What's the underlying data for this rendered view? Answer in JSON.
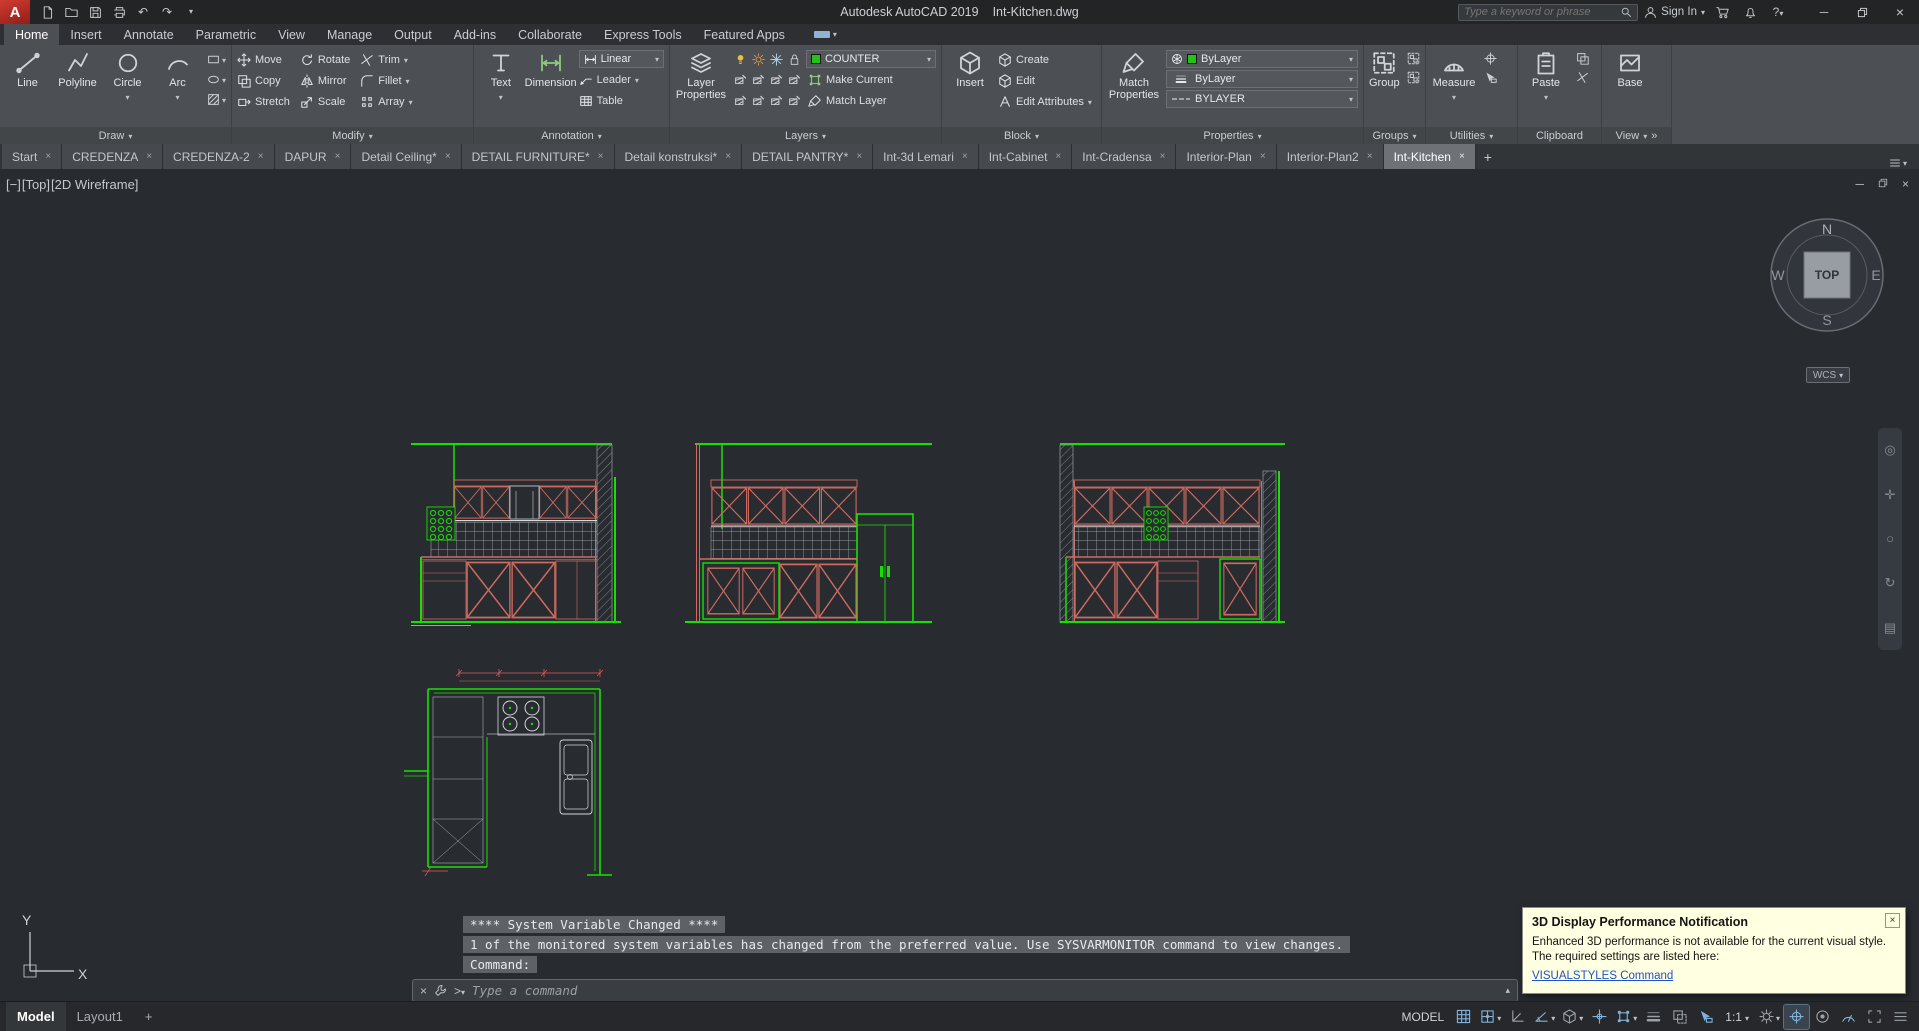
{
  "title_bar": {
    "app_title": "Autodesk AutoCAD 2019",
    "doc_title": "Int-Kitchen.dwg",
    "search_placeholder": "Type a keyword or phrase",
    "sign_in_label": "Sign In"
  },
  "menu_tabs": [
    {
      "label": "Home",
      "active": true
    },
    {
      "label": "Insert"
    },
    {
      "label": "Annotate"
    },
    {
      "label": "Parametric"
    },
    {
      "label": "View"
    },
    {
      "label": "Manage"
    },
    {
      "label": "Output"
    },
    {
      "label": "Add-ins"
    },
    {
      "label": "Collaborate"
    },
    {
      "label": "Express Tools"
    },
    {
      "label": "Featured Apps"
    }
  ],
  "ribbon": {
    "draw": {
      "title": "Draw",
      "buttons": [
        "Line",
        "Polyline",
        "Circle",
        "Arc"
      ]
    },
    "modify": {
      "title": "Modify",
      "buttons": [
        "Move",
        "Rotate",
        "Trim",
        "Copy",
        "Mirror",
        "Fillet",
        "Stretch",
        "Scale",
        "Array"
      ]
    },
    "annotation": {
      "title": "Annotation",
      "text": "Text",
      "dimension": "Dimension",
      "linear": "Linear",
      "leader": "Leader",
      "table": "Table"
    },
    "layers": {
      "title": "Layers",
      "layer_properties": "Layer Properties",
      "current_layer": "COUNTER",
      "make_current": "Make Current",
      "match_layer": "Match Layer"
    },
    "block": {
      "title": "Block",
      "insert": "Insert",
      "create": "Create",
      "edit": "Edit",
      "edit_attributes": "Edit Attributes"
    },
    "properties": {
      "title": "Properties",
      "match_properties": "Match Properties",
      "color": "ByLayer",
      "lineweight": "ByLayer",
      "linetype": "BYLAYER"
    },
    "groups": {
      "title": "Groups",
      "group": "Group"
    },
    "utilities": {
      "title": "Utilities",
      "measure": "Measure"
    },
    "clipboard": {
      "title": "Clipboard",
      "paste": "Paste"
    },
    "view": {
      "title": "View",
      "base": "Base"
    }
  },
  "file_tabs": [
    {
      "label": "Start"
    },
    {
      "label": "CREDENZA"
    },
    {
      "label": "CREDENZA-2"
    },
    {
      "label": "DAPUR"
    },
    {
      "label": "Detail Ceiling*"
    },
    {
      "label": "DETAIL FURNITURE*"
    },
    {
      "label": "Detail konstruksi*"
    },
    {
      "label": "DETAIL PANTRY*"
    },
    {
      "label": "Int-3d Lemari"
    },
    {
      "label": "Int-Cabinet"
    },
    {
      "label": "Int-Cradensa"
    },
    {
      "label": "Interior-Plan"
    },
    {
      "label": "Interior-Plan2"
    },
    {
      "label": "Int-Kitchen",
      "active": true
    }
  ],
  "viewport": {
    "minus_control": "[−]",
    "view_control": "[Top]",
    "visual_style_control": "[2D Wireframe]",
    "compass": {
      "north": "N",
      "south": "S",
      "east": "E",
      "west": "W",
      "cube_face": "TOP"
    },
    "wcs_label": "WCS",
    "ucs": {
      "x": "X",
      "y": "Y"
    }
  },
  "command_line": {
    "history_1": "**** System Variable Changed ****",
    "history_2": "1 of the monitored system variables has changed from the preferred value. Use SYSVARMONITOR command to view changes.",
    "history_3": "Command:",
    "input_placeholder": "Type a command"
  },
  "notification": {
    "title": "3D Display Performance Notification",
    "body_line1": "Enhanced 3D performance is not available for the current visual style.",
    "body_line2": "The required settings are listed here:",
    "link_label": "VISUALSTYLES Command"
  },
  "status_bar": {
    "model_tab": "Model",
    "layout_tab": "Layout1",
    "add_layout_label": "+",
    "model_space_label": "MODEL",
    "annotation_scale": "1:1"
  },
  "colors": {
    "accent_green": "#17e000",
    "accent_red": "#d06a5f",
    "canvas_bg": "#282c31",
    "notification_bg": "#ffffe1"
  }
}
